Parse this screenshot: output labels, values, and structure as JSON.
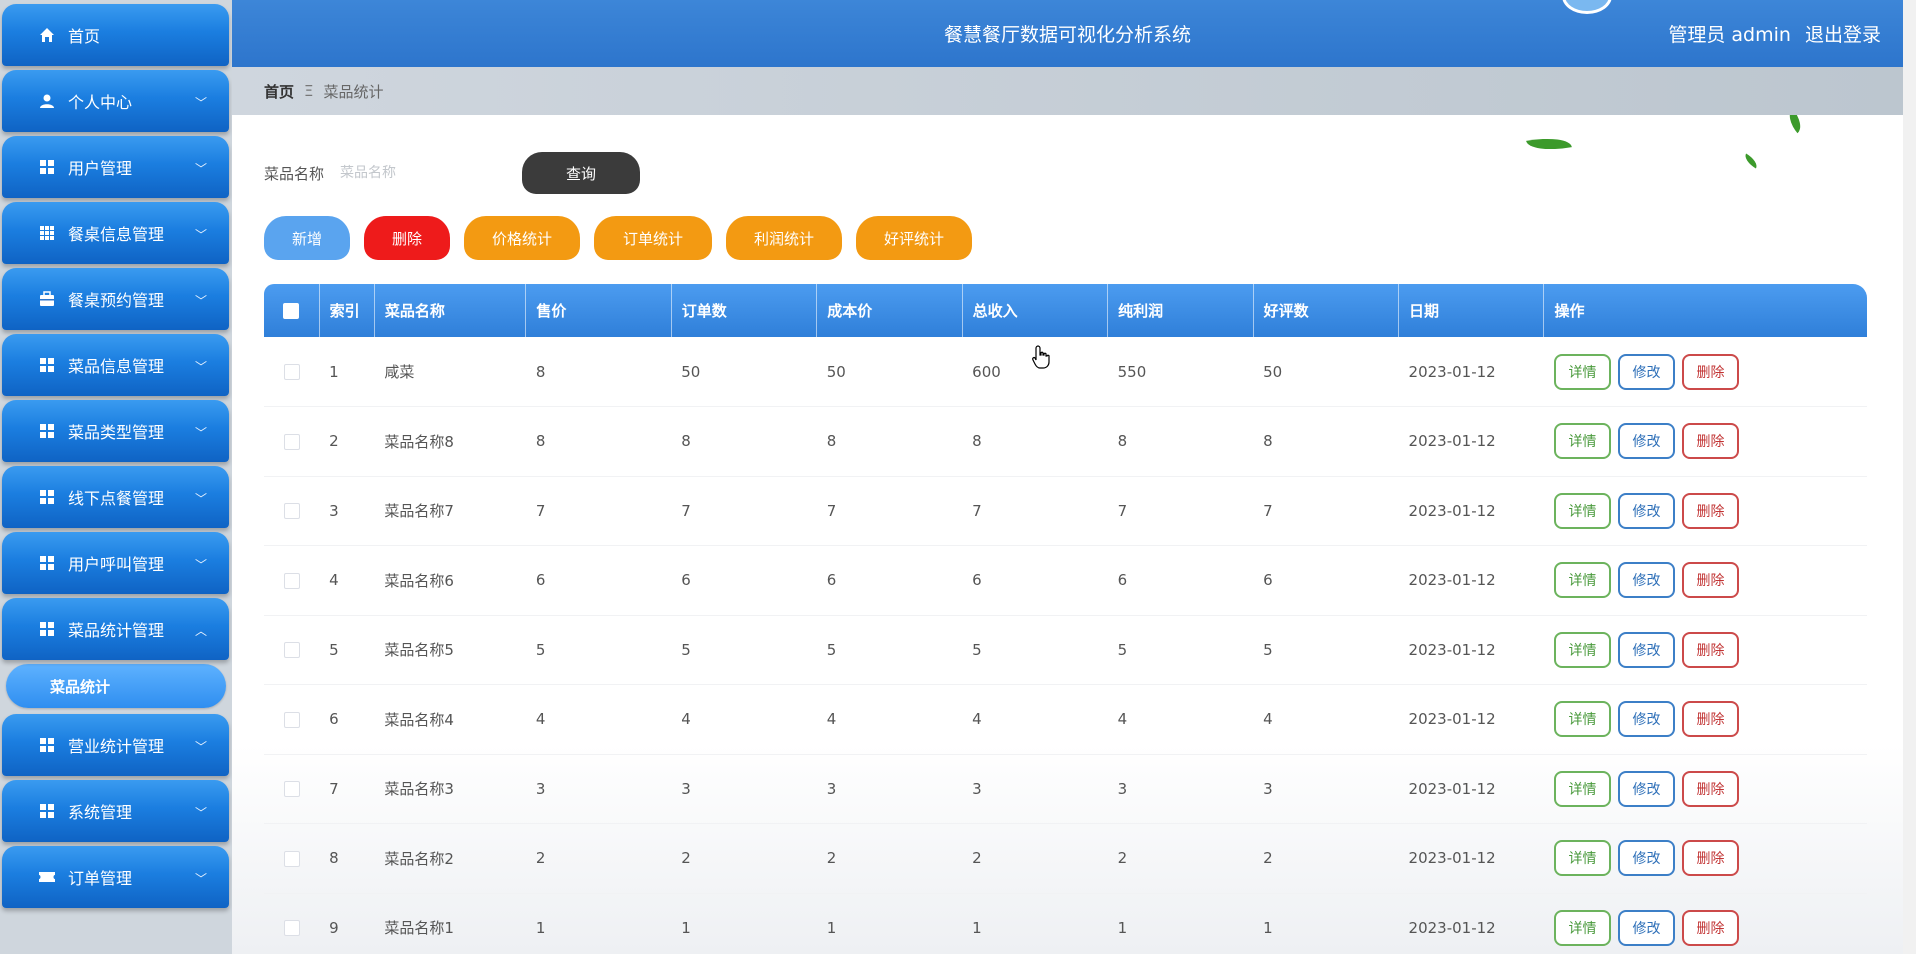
{
  "sidebar": {
    "items": [
      {
        "label": "首页",
        "icon": "home-icon",
        "chevron": false
      },
      {
        "label": "个人中心",
        "icon": "user-icon",
        "chevron": true
      },
      {
        "label": "用户管理",
        "icon": "grid-icon",
        "chevron": true
      },
      {
        "label": "餐桌信息管理",
        "icon": "grid9-icon",
        "chevron": true
      },
      {
        "label": "餐桌预约管理",
        "icon": "briefcase-icon",
        "chevron": true
      },
      {
        "label": "菜品信息管理",
        "icon": "grid-icon",
        "chevron": true
      },
      {
        "label": "菜品类型管理",
        "icon": "grid-icon",
        "chevron": true
      },
      {
        "label": "线下点餐管理",
        "icon": "grid-icon",
        "chevron": true
      },
      {
        "label": "用户呼叫管理",
        "icon": "grid-icon",
        "chevron": true
      },
      {
        "label": "菜品统计管理",
        "icon": "grid-icon",
        "chevron": true,
        "expanded": true
      },
      {
        "label": "营业统计管理",
        "icon": "grid-icon",
        "chevron": true
      },
      {
        "label": "系统管理",
        "icon": "grid-icon",
        "chevron": true
      },
      {
        "label": "订单管理",
        "icon": "ticket-icon",
        "chevron": true
      }
    ],
    "sub_item_active": "菜品统计"
  },
  "header": {
    "title": "餐慧餐厅数据可视化分析系统",
    "user": "管理员 admin",
    "logout": "退出登录"
  },
  "breadcrumb": {
    "home": "首页",
    "separator": "Ξ",
    "current": "菜品统计"
  },
  "search": {
    "label": "菜品名称",
    "placeholder": "菜品名称",
    "value": "",
    "query_button": "查询"
  },
  "actions": {
    "add": "新增",
    "delete": "删除",
    "price_stats": "价格统计",
    "order_stats": "订单统计",
    "profit_stats": "利润统计",
    "rating_stats": "好评统计"
  },
  "table": {
    "headers": [
      "索引",
      "菜品名称",
      "售价",
      "订单数",
      "成本价",
      "总收入",
      "纯利润",
      "好评数",
      "日期",
      "操作"
    ],
    "rows": [
      [
        "1",
        "咸菜",
        "8",
        "50",
        "50",
        "600",
        "550",
        "50",
        "2023-01-12"
      ],
      [
        "2",
        "菜品名称8",
        "8",
        "8",
        "8",
        "8",
        "8",
        "8",
        "2023-01-12"
      ],
      [
        "3",
        "菜品名称7",
        "7",
        "7",
        "7",
        "7",
        "7",
        "7",
        "2023-01-12"
      ],
      [
        "4",
        "菜品名称6",
        "6",
        "6",
        "6",
        "6",
        "6",
        "6",
        "2023-01-12"
      ],
      [
        "5",
        "菜品名称5",
        "5",
        "5",
        "5",
        "5",
        "5",
        "5",
        "2023-01-12"
      ],
      [
        "6",
        "菜品名称4",
        "4",
        "4",
        "4",
        "4",
        "4",
        "4",
        "2023-01-12"
      ],
      [
        "7",
        "菜品名称3",
        "3",
        "3",
        "3",
        "3",
        "3",
        "3",
        "2023-01-12"
      ],
      [
        "8",
        "菜品名称2",
        "2",
        "2",
        "2",
        "2",
        "2",
        "2",
        "2023-01-12"
      ],
      [
        "9",
        "菜品名称1",
        "1",
        "1",
        "1",
        "1",
        "1",
        "1",
        "2023-01-12"
      ]
    ],
    "op_detail": "详情",
    "op_edit": "修改",
    "op_delete": "删除"
  },
  "colors": {
    "header_blue": "#2d75cc",
    "sidebar_blue": "#1b7ee0",
    "orange": "#f39a12",
    "red": "#ee1b1b",
    "dark": "#3b3b3b"
  }
}
